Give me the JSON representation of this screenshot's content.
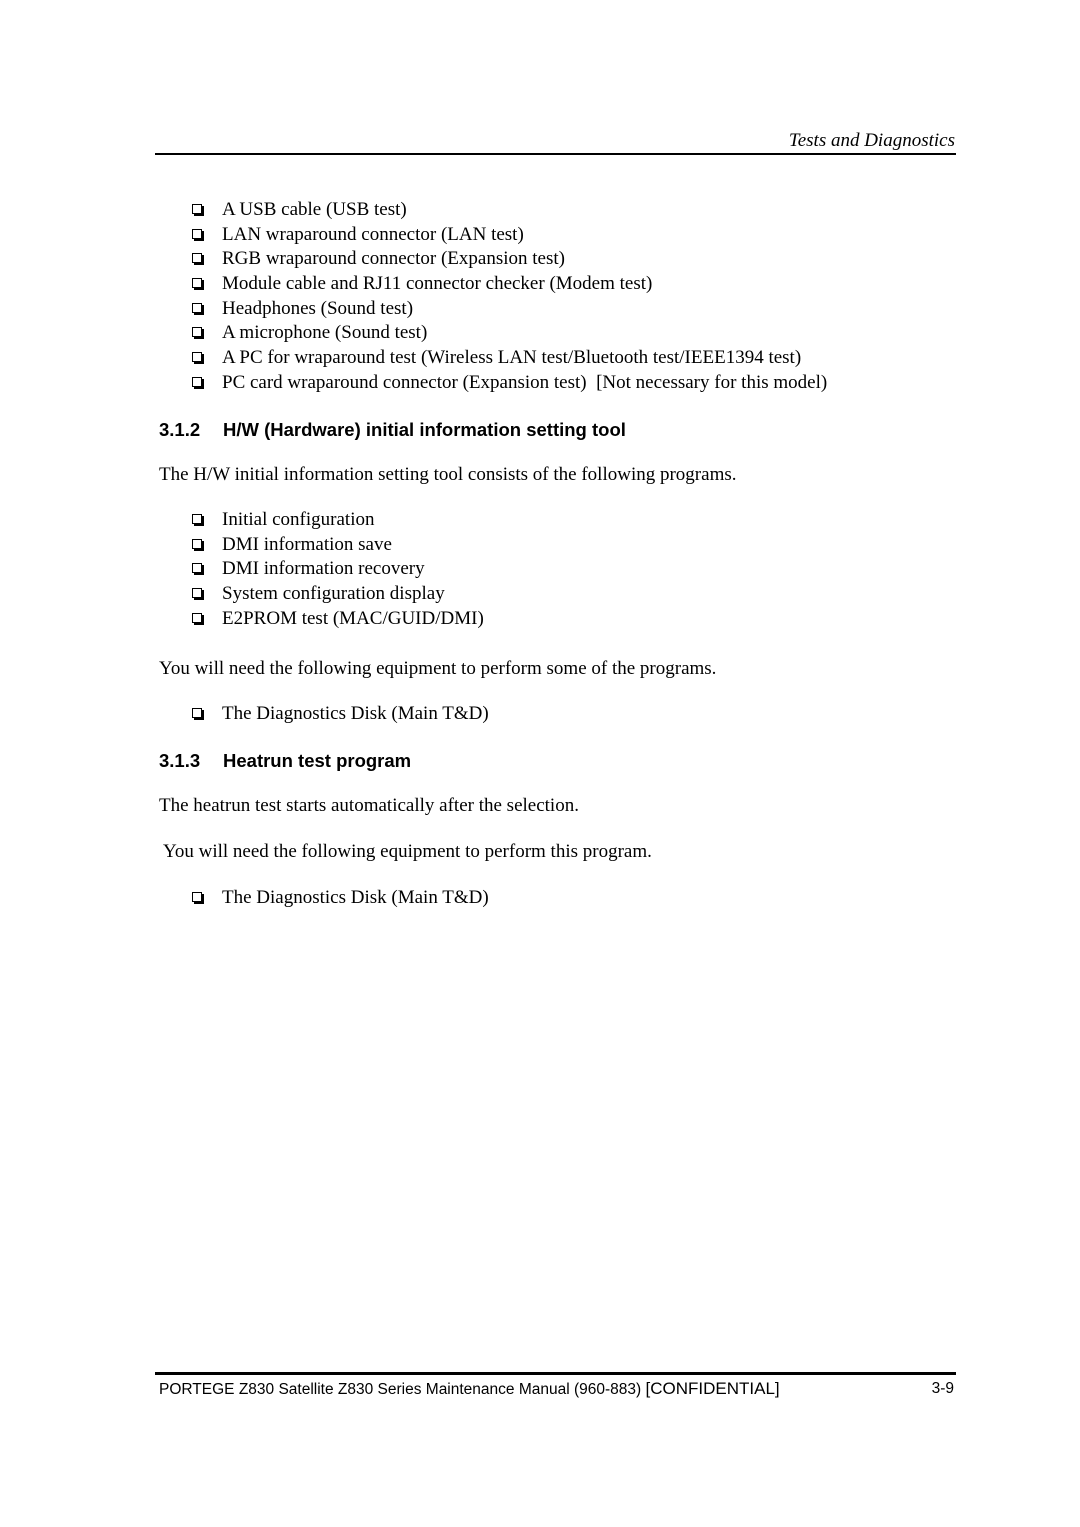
{
  "header": {
    "running_title": "Tests and Diagnostics"
  },
  "equipment_list_continued": [
    "A USB cable (USB test)",
    "LAN wraparound connector (LAN test)",
    "RGB wraparound connector (Expansion test)",
    "Module cable and RJ11 connector checker (Modem test)",
    "Headphones (Sound test)",
    "A microphone (Sound test)",
    "A PC for wraparound test (Wireless LAN test/Bluetooth test/IEEE1394 test)",
    "PC card wraparound connector (Expansion test)  [Not necessary for this model)"
  ],
  "section_312": {
    "number": "3.1.2",
    "title": "H/W (Hardware) initial information setting tool",
    "intro": "The H/W initial information setting tool consists of the following programs.",
    "programs": [
      "Initial configuration",
      "DMI information save",
      "DMI information recovery",
      "System configuration display",
      "E2PROM test (MAC/GUID/DMI)"
    ],
    "equipment_intro": "You will need the following equipment to perform some of the programs.",
    "equipment": [
      "The Diagnostics Disk (Main T&D)"
    ]
  },
  "section_313": {
    "number": "3.1.3",
    "title": "Heatrun test program",
    "intro": "The heatrun test starts automatically after the selection.",
    "equipment_intro": " You will need the following equipment to perform this program.",
    "equipment": [
      "The Diagnostics Disk (Main T&D)"
    ]
  },
  "footer": {
    "manual_title": "PORTEGE Z830 Satellite Z830 Series Maintenance Manual (960-883) ",
    "confidential": "[CONFIDENTIAL]",
    "page_number": "3-9"
  },
  "icons": {
    "bullet": "checkbox-square-icon"
  }
}
